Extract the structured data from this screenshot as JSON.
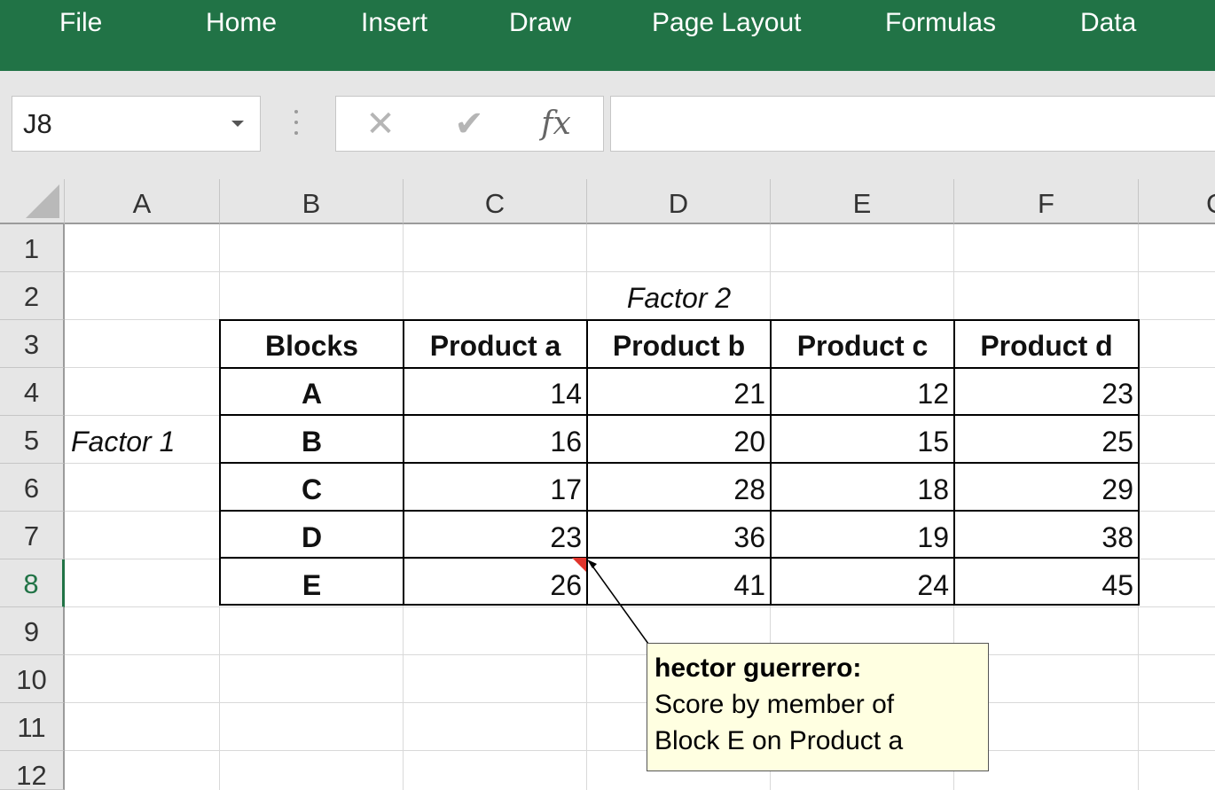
{
  "ribbon": {
    "tabs": [
      "File",
      "Home",
      "Insert",
      "Draw",
      "Page Layout",
      "Formulas",
      "Data"
    ],
    "accent_color": "#217346"
  },
  "formula_bar": {
    "name_box": "J8",
    "cancel_icon": "✕",
    "enter_icon": "✔",
    "function_icon": "fx",
    "formula": ""
  },
  "grid": {
    "columns": [
      "A",
      "B",
      "C",
      "D",
      "E",
      "F",
      "G"
    ],
    "rows": [
      "1",
      "2",
      "3",
      "4",
      "5",
      "6",
      "7",
      "8",
      "9",
      "10",
      "11",
      "12"
    ],
    "active_row": "8"
  },
  "sheet": {
    "factor2_label": "Factor 2",
    "factor1_label": "Factor 1",
    "header": [
      "Blocks",
      "Product a",
      "Product b",
      "Product c",
      "Product d"
    ],
    "rows": [
      {
        "block": "A",
        "values": [
          "14",
          "21",
          "12",
          "23"
        ]
      },
      {
        "block": "B",
        "values": [
          "16",
          "20",
          "15",
          "25"
        ]
      },
      {
        "block": "C",
        "values": [
          "17",
          "28",
          "18",
          "29"
        ]
      },
      {
        "block": "D",
        "values": [
          "23",
          "36",
          "19",
          "38"
        ]
      },
      {
        "block": "E",
        "values": [
          "26",
          "41",
          "24",
          "45"
        ]
      }
    ]
  },
  "comment": {
    "author": "hector guerrero:",
    "text": "Score by member of Block E on Product a",
    "marker_color": "#e0342b"
  }
}
